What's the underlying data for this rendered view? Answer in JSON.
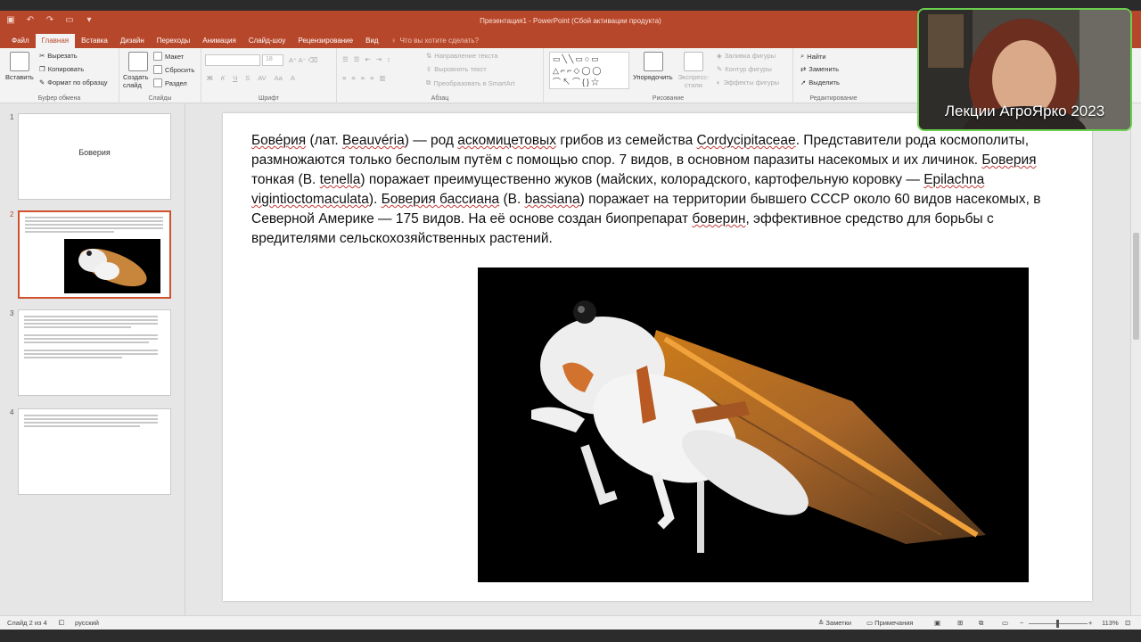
{
  "window": {
    "title": "Презентация1 - PowerPoint (Сбой активации продукта)"
  },
  "tabs": [
    "Файл",
    "Главная",
    "Вставка",
    "Дизайн",
    "Переходы",
    "Анимация",
    "Слайд-шоу",
    "Рецензирование",
    "Вид"
  ],
  "active_tab": "Главная",
  "tell_me": "Что вы хотите сделать?",
  "ribbon": {
    "clipboard": {
      "paste": "Вставить",
      "cut": "Вырезать",
      "copy": "Копировать",
      "format_painter": "Формат по образцу",
      "label": "Буфер обмена"
    },
    "slides": {
      "new_slide": "Создать слайд",
      "layout": "Макет",
      "reset": "Сбросить",
      "section": "Раздел",
      "label": "Слайды"
    },
    "font": {
      "size": "18",
      "label": "Шрифт"
    },
    "paragraph": {
      "text_direction": "Направление текста",
      "align_text": "Выровнять текст",
      "smartart": "Преобразовать в SmartArt",
      "label": "Абзац"
    },
    "drawing": {
      "arrange": "Упорядочить",
      "quick_styles": "Экспресс-стили",
      "shape_fill": "Заливка фигуры",
      "shape_outline": "Контур фигуры",
      "shape_effects": "Эффекты фигуры",
      "label": "Рисование"
    },
    "editing": {
      "find": "Найти",
      "replace": "Заменить",
      "select": "Выделить",
      "label": "Редактирование"
    }
  },
  "thumbnails": [
    {
      "num": "1",
      "title": "Боверия"
    },
    {
      "num": "2"
    },
    {
      "num": "3"
    },
    {
      "num": "4"
    }
  ],
  "slide": {
    "parts": [
      {
        "t": "Бове́рия",
        "u": true
      },
      {
        "t": " (лат. ",
        "u": false
      },
      {
        "t": "Beauvéria",
        "u": true
      },
      {
        "t": ") — род ",
        "u": false
      },
      {
        "t": "аскомицетовых",
        "u": true
      },
      {
        "t": " грибов из семейства ",
        "u": false
      },
      {
        "t": "Cordycipitaceae",
        "u": true
      },
      {
        "t": ". Представители рода космополиты, размножаются только бесполым путём с помощью спор. 7 видов, в основном паразиты насекомых и их личинок. ",
        "u": false
      },
      {
        "t": "Боверия",
        "u": true
      },
      {
        "t": " тонкая (B. ",
        "u": false
      },
      {
        "t": "tenella",
        "u": true
      },
      {
        "t": ") поражает преимущественно жуков (майских, колорадского, картофельную коровку — ",
        "u": false
      },
      {
        "t": "Epilachna vigintioctomaculata",
        "u": true
      },
      {
        "t": "). ",
        "u": false
      },
      {
        "t": "Боверия бассиана",
        "u": true
      },
      {
        "t": " (B. ",
        "u": false
      },
      {
        "t": "bassiana",
        "u": true
      },
      {
        "t": ") поражает на территории бывшего СССР около 60 видов насекомых, в Северной Америке — 175 видов. На её основе создан биопрепарат ",
        "u": false
      },
      {
        "t": "боверин",
        "u": true
      },
      {
        "t": ", эффективное средство для борьбы с вредителями сельскохозяйственных растений.",
        "u": false
      }
    ]
  },
  "status": {
    "slide_info": "Слайд 2 из 4",
    "language": "русский",
    "notes": "Заметки",
    "comments": "Примечания",
    "zoom": "113%"
  },
  "webcam": {
    "label": "Лекции АгроЯрко 2023"
  },
  "colors": {
    "accent": "#b7472a",
    "webcam_border": "#6bcf4e"
  }
}
